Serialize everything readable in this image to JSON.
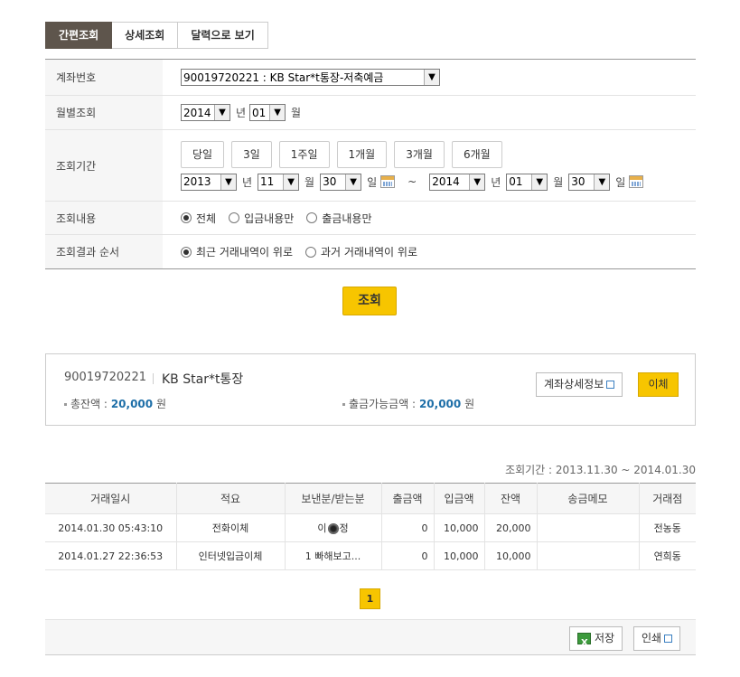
{
  "tabs": [
    {
      "label": "간편조회",
      "active": true
    },
    {
      "label": "상세조회",
      "active": false
    },
    {
      "label": "달력으로 보기",
      "active": false
    }
  ],
  "form": {
    "account_label": "계좌번호",
    "account_value": "90019720221 : KB Star*t통장-저축예금",
    "month_label": "월별조회",
    "month_year": "2014",
    "month_month": "01",
    "unit_year": "년",
    "unit_month": "월",
    "unit_day": "일",
    "period_label": "조회기간",
    "period_buttons": [
      "당일",
      "3일",
      "1주일",
      "1개월",
      "3개월",
      "6개월"
    ],
    "from_year": "2013",
    "from_month": "11",
    "from_day": "30",
    "tilde": "~",
    "to_year": "2014",
    "to_month": "01",
    "to_day": "30",
    "content_label": "조회내용",
    "content_options": [
      "전체",
      "입금내용만",
      "출금내용만"
    ],
    "order_label": "조회결과 순서",
    "order_options": [
      "최근 거래내역이 위로",
      "과거 거래내역이 위로"
    ]
  },
  "search_button": "조회",
  "account": {
    "number": "90019720221",
    "name": "KB Star*t통장",
    "total_label": "총잔액 :",
    "total_value": "20,000",
    "won": "원",
    "avail_label": "출금가능금액 :",
    "avail_value": "20,000",
    "detail_button": "계좌상세정보",
    "transfer_button": "이체"
  },
  "period_text": "조회기간 : 2013.11.30 ~ 2014.01.30",
  "table": {
    "headers": [
      "거래일시",
      "적요",
      "보낸분/받는분",
      "출금액",
      "입금액",
      "잔액",
      "송금메모",
      "거래점"
    ],
    "rows": [
      [
        "2014.01.30 05:43:10",
        "전화이체",
        "이",
        "0",
        "10,000",
        "20,000",
        "",
        "전농동"
      ],
      [
        "2014.01.27 22:36:53",
        "인터넷입금이체",
        "1 빠해보고...",
        "0",
        "10,000",
        "10,000",
        "",
        "연희동"
      ]
    ],
    "row1_sender_suffix": "정"
  },
  "pagination": {
    "current": "1"
  },
  "footer": {
    "save_button": "저장",
    "print_button": "인쇄"
  }
}
